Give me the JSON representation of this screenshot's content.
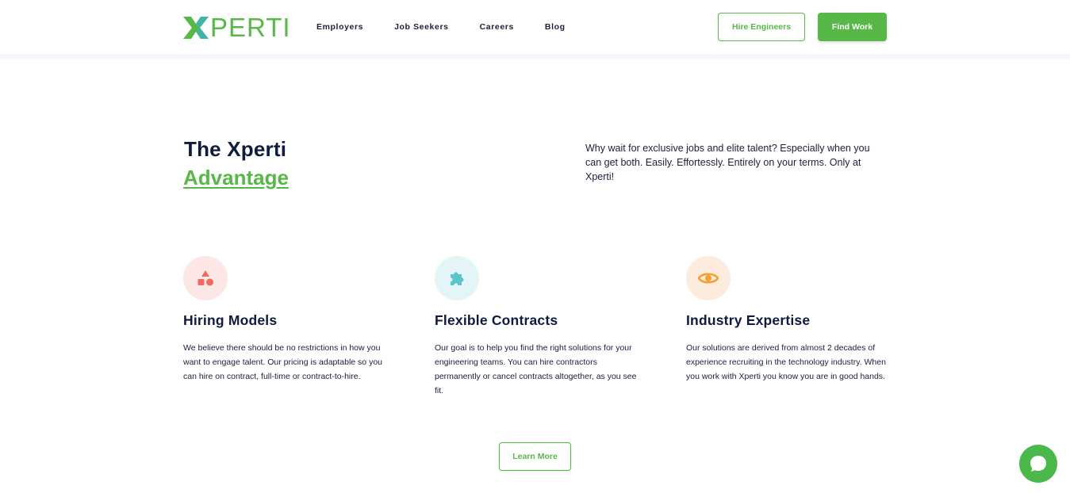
{
  "header": {
    "logo_text": "PERTI",
    "nav": [
      "Employers",
      "Job Seekers",
      "Careers",
      "Blog"
    ],
    "hire_button": "Hire Engineers",
    "find_button": "Find Work"
  },
  "hero": {
    "title_line1": "The Xperti",
    "title_line2": "Advantage",
    "intro": "Why wait for exclusive jobs and elite talent? Especially when you can get both. Easily. Effortessly. Entirely on your terms. Only at Xperti!"
  },
  "features": [
    {
      "icon": "shapes-icon",
      "title": "Hiring Models",
      "description": "We believe there should be no restrictions in how you want to engage talent. Our pricing is adaptable so you can hire on contract, full-time or contract-to-hire."
    },
    {
      "icon": "puzzle-icon",
      "title": "Flexible Contracts",
      "description": "Our goal is to help you find the right solutions for your engineering teams. You can hire contractors permanently or cancel contracts altogether, as you see fit."
    },
    {
      "icon": "eye-icon",
      "title": "Industry Expertise",
      "description": "Our solutions are derived from almost 2 decades of experience recruiting in the technology industry. When you work with Xperti you know you are in good hands."
    }
  ],
  "learn_more": "Learn More",
  "colors": {
    "brand_green": "#58b847",
    "heading_navy": "#0f1b3d",
    "icon_red": "#f06a5e",
    "icon_teal": "#5cc4cc",
    "icon_orange": "#f4a02c"
  }
}
